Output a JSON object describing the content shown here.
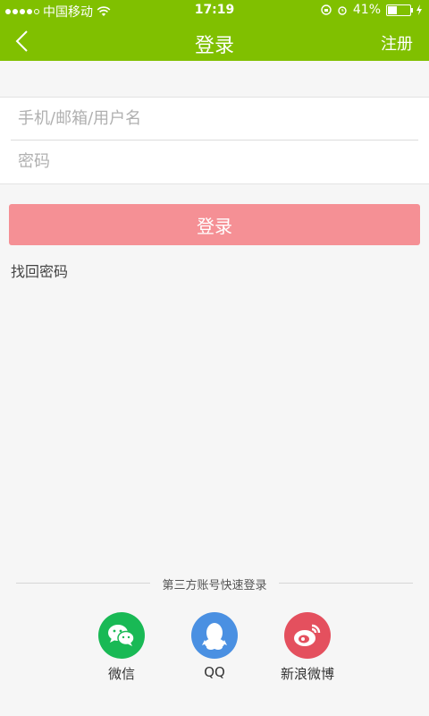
{
  "status_bar": {
    "carrier": "中国移动",
    "time": "17:19",
    "battery_percent": "41%"
  },
  "nav": {
    "title": "登录",
    "register_label": "注册"
  },
  "form": {
    "username_placeholder": "手机/邮箱/用户名",
    "username_value": "",
    "password_placeholder": "密码",
    "password_value": ""
  },
  "login_button_label": "登录",
  "forgot_password_label": "找回密码",
  "third_party": {
    "heading": "第三方账号快速登录",
    "options": [
      {
        "label": "微信",
        "icon": "wechat-icon",
        "color": "#19b955"
      },
      {
        "label": "QQ",
        "icon": "qq-icon",
        "color": "#4a90e2"
      },
      {
        "label": "新浪微博",
        "icon": "weibo-icon",
        "color": "#e4505e"
      }
    ]
  },
  "colors": {
    "header": "#80c000",
    "login_button": "#f59095"
  }
}
